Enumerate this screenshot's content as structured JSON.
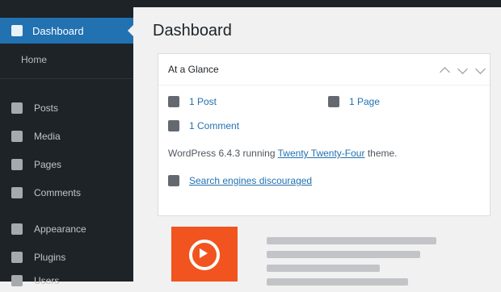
{
  "sidebar": {
    "active": {
      "label": "Dashboard",
      "icon": "dashboard-icon"
    },
    "sub_item": "Home",
    "items": [
      {
        "label": "Posts",
        "icon": "pin-icon"
      },
      {
        "label": "Media",
        "icon": "media-icon"
      },
      {
        "label": "Pages",
        "icon": "page-icon"
      },
      {
        "label": "Comments",
        "icon": "comment-icon"
      },
      {
        "label": "Appearance",
        "icon": "brush-icon"
      },
      {
        "label": "Plugins",
        "icon": "plugin-icon"
      },
      {
        "label": "Users",
        "icon": "user-icon"
      }
    ]
  },
  "page": {
    "title": "Dashboard"
  },
  "glance": {
    "title": "At a Glance",
    "items": [
      {
        "label": "1 Post",
        "icon": "pin-icon"
      },
      {
        "label": "1 Page",
        "icon": "page-icon"
      },
      {
        "label": "1 Comment",
        "icon": "comment-icon"
      }
    ],
    "wp_prefix": "WordPress 6.4.3 running",
    "wp_theme": "Twenty Twenty-Four",
    "wp_suffix": "theme.",
    "search_label": "Search engines discouraged",
    "search_icon": "alert-icon"
  },
  "colors": {
    "sidebar": "#1d2327",
    "accent": "#2271b1",
    "promo": "#f1541f"
  }
}
